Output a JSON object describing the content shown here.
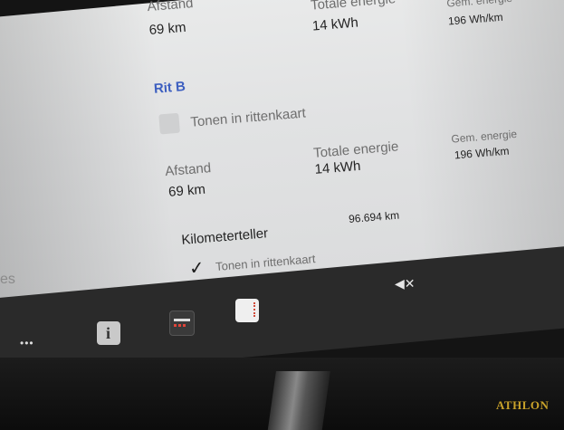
{
  "trip_a": {
    "distance_label": "Afstand",
    "distance_value": "69 km",
    "total_energy_label": "Totale energie",
    "total_energy_value": "14 kWh",
    "avg_energy_label": "Gem. energie",
    "avg_energy_value": "196 Wh/km"
  },
  "trip_b": {
    "title": "Rit B",
    "show_on_map_label": "Tonen in rittenkaart",
    "distance_label": "Afstand",
    "distance_value": "69 km",
    "total_energy_label": "Totale energie",
    "total_energy_value": "14 kWh",
    "avg_energy_label": "Gem. energie",
    "avg_energy_value": "196 Wh/km"
  },
  "odometer": {
    "label": "Kilometerteller",
    "value": "96.694 km",
    "show_on_map_label": "Tonen in rittenkaart"
  },
  "left_edge_fragment": "es",
  "taskbar": {
    "more_glyph": "•••",
    "mute_glyph": "◀✕"
  },
  "brand": {
    "logo_text": "ATHLON"
  }
}
